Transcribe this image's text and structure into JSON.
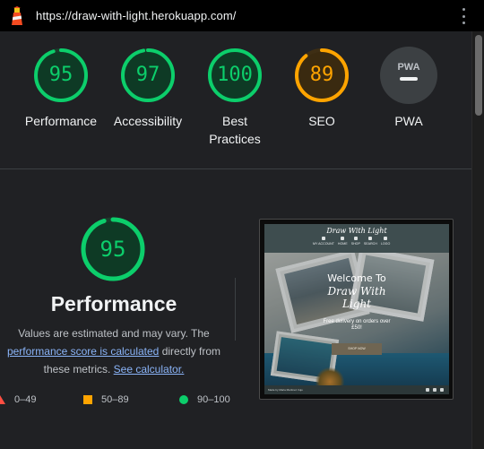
{
  "browser": {
    "url": "https://draw-with-light.herokuapp.com/"
  },
  "colors": {
    "pass": "#0cce6b",
    "average": "#ffa400",
    "fail": "#ff4e42"
  },
  "categories": [
    {
      "key": "performance",
      "label": "Performance",
      "score": 95,
      "status": "pass"
    },
    {
      "key": "accessibility",
      "label": "Accessibility",
      "score": 97,
      "status": "pass"
    },
    {
      "key": "best_practices",
      "label": "Best\nPractices",
      "score": 100,
      "status": "pass"
    },
    {
      "key": "seo",
      "label": "SEO",
      "score": 89,
      "status": "average"
    },
    {
      "key": "pwa",
      "label": "PWA",
      "score": null,
      "status": "na",
      "badge_text": "PWA"
    }
  ],
  "performance_detail": {
    "score": 95,
    "title": "Performance",
    "desc_prefix": "Values are estimated and may vary. The ",
    "desc_link1": "performance score is calculated",
    "desc_middle": " directly from these metrics. ",
    "desc_link2": "See calculator."
  },
  "legend": [
    {
      "range": "0–49",
      "shape": "triangle",
      "status": "fail"
    },
    {
      "range": "50–89",
      "shape": "square",
      "status": "average"
    },
    {
      "range": "90–100",
      "shape": "circle",
      "status": "pass"
    }
  ],
  "screenshot_preview": {
    "logo": "Draw With Light",
    "nav": [
      "MY ACCOUNT",
      "HOME",
      "SHOP",
      "SEARCH",
      "LOGO"
    ],
    "welcome_line1": "Welcome To",
    "welcome_line2": "Draw With",
    "welcome_line3": "Light",
    "delivery": "Free delivery on orders over £50!",
    "shop_button": "SHOP NOW",
    "footer_text": "Made by Maria Martinez Irujo"
  }
}
